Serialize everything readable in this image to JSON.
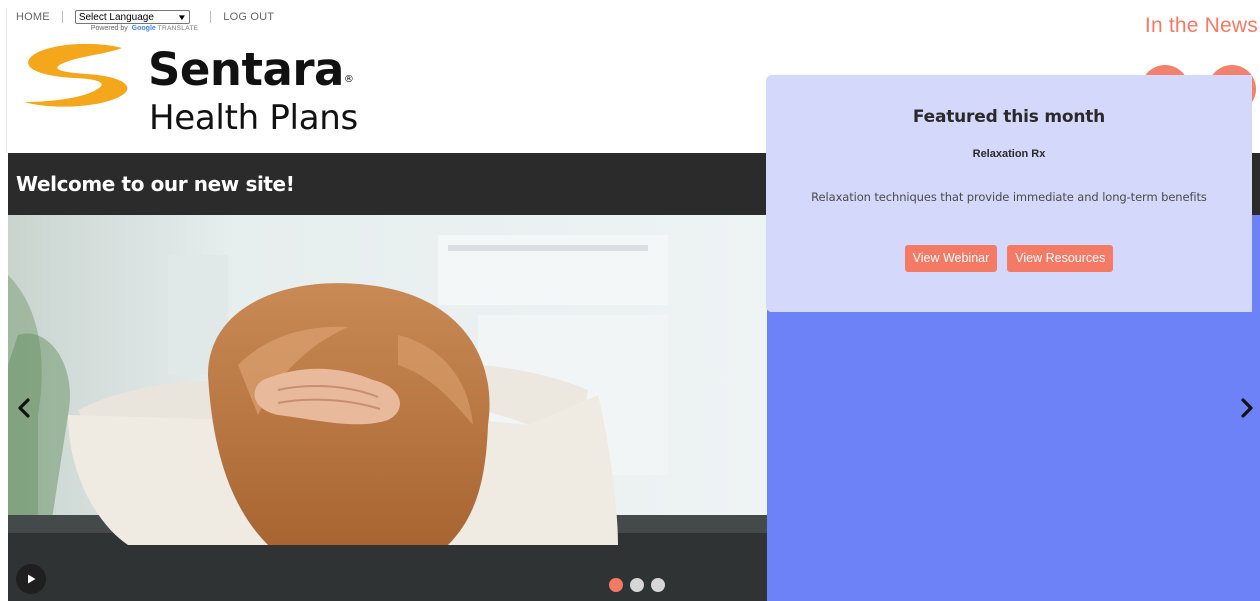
{
  "utility": {
    "home_label": "HOME",
    "language_select": "Select Language",
    "powered_by": "Powered by",
    "google_word": "Google",
    "translate_word": "TRANSLATE",
    "logout_label": "LOG OUT"
  },
  "logo": {
    "wordmark": "Sentara",
    "registered_mark": "®",
    "tagline": "Health Plans",
    "colors": {
      "swoosh": "#f5a71c",
      "text": "#111111"
    }
  },
  "header": {
    "news_link": "In the News",
    "search_icon": "search-icon",
    "phone_icon": "phone-icon",
    "accent_color": "#f47a66"
  },
  "welcome": {
    "text": "Welcome to our new site!"
  },
  "carousel": {
    "prev_glyph": "‹",
    "next_glyph": "›",
    "dots_total": 3,
    "dots_active_index": 0,
    "panel_color": "#6d82f7",
    "card_color": "#d4d9fc",
    "feature": {
      "heading": "Featured this month",
      "subtitle": "Relaxation Rx",
      "description": "Relaxation techniques that provide immediate and long-term benefits",
      "buttons": [
        "View Webinar",
        "View Resources"
      ]
    }
  }
}
